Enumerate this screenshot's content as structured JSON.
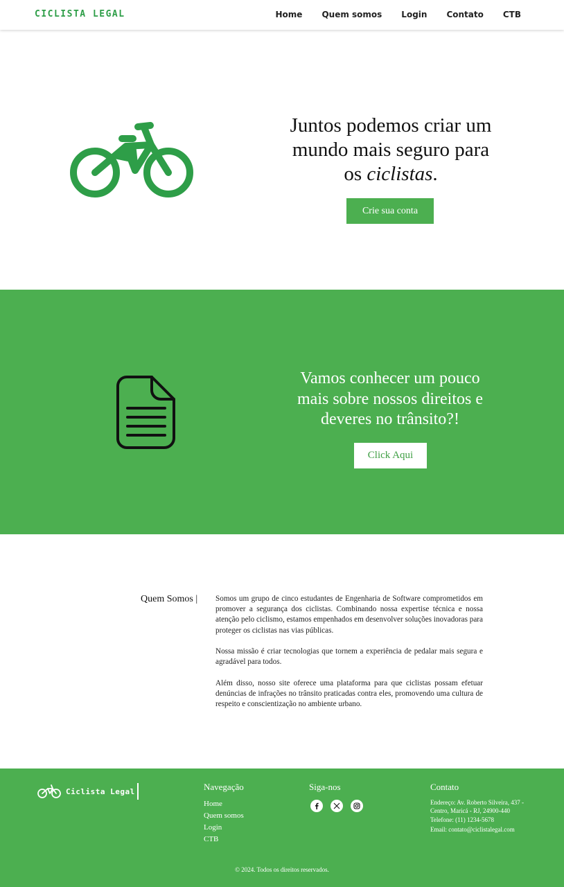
{
  "header": {
    "logo": "Ciclista Legal",
    "nav": [
      "Home",
      "Quem somos",
      "Login",
      "Contato",
      "CTB"
    ]
  },
  "hero": {
    "title_line1": "Juntos podemos criar um",
    "title_line2": "mundo mais seguro para",
    "title_line3_prefix": "os ",
    "title_line3_em": "ciclistas",
    "title_line3_suffix": ".",
    "button": "Crie sua conta",
    "icon": "bicycle-icon"
  },
  "rights": {
    "title": "Vamos conhecer um pouco mais sobre nossos direitos e deveres no trânsito?!",
    "button": "Click Aqui",
    "icon": "document-icon"
  },
  "about": {
    "label": "Quem Somos |",
    "paragraphs": [
      "Somos um grupo de cinco estudantes de Engenharia de Software comprometidos em promover a segurança dos ciclistas. Combinando nossa expertise técnica e nossa atenção pelo ciclismo, estamos empenhados em desenvolver soluções inovadoras para proteger os ciclistas nas vias públicas.",
      "Nossa missão é criar tecnologias que tornem a experiência de pedalar mais segura e agradável para todos.",
      "Além disso, nosso site oferece uma plataforma para que ciclistas possam efetuar denúncias de infrações no trânsito praticadas contra eles, promovendo uma cultura de respeito e conscientização no ambiente urbano."
    ]
  },
  "footer": {
    "logo": "Ciclista Legal",
    "nav_title": "Navegação",
    "nav_links": [
      "Home",
      "Quem somos",
      "Login",
      "CTB"
    ],
    "social_title": "Siga-nos",
    "socials": [
      "facebook-icon",
      "x-icon",
      "instagram-icon"
    ],
    "contact_title": "Contato",
    "address": "Endereço: Av. Roberto Silveira, 437 - Centro, Maricá - RJ, 24900-440",
    "phone": "Telefone: (11) 1234-5678",
    "email": "Email: contato@ciclistalegal.com",
    "copyright": "© 2024. Todos os direitos reservados."
  },
  "colors": {
    "brand_green": "#4caf50",
    "logo_green": "#2e9e48"
  }
}
